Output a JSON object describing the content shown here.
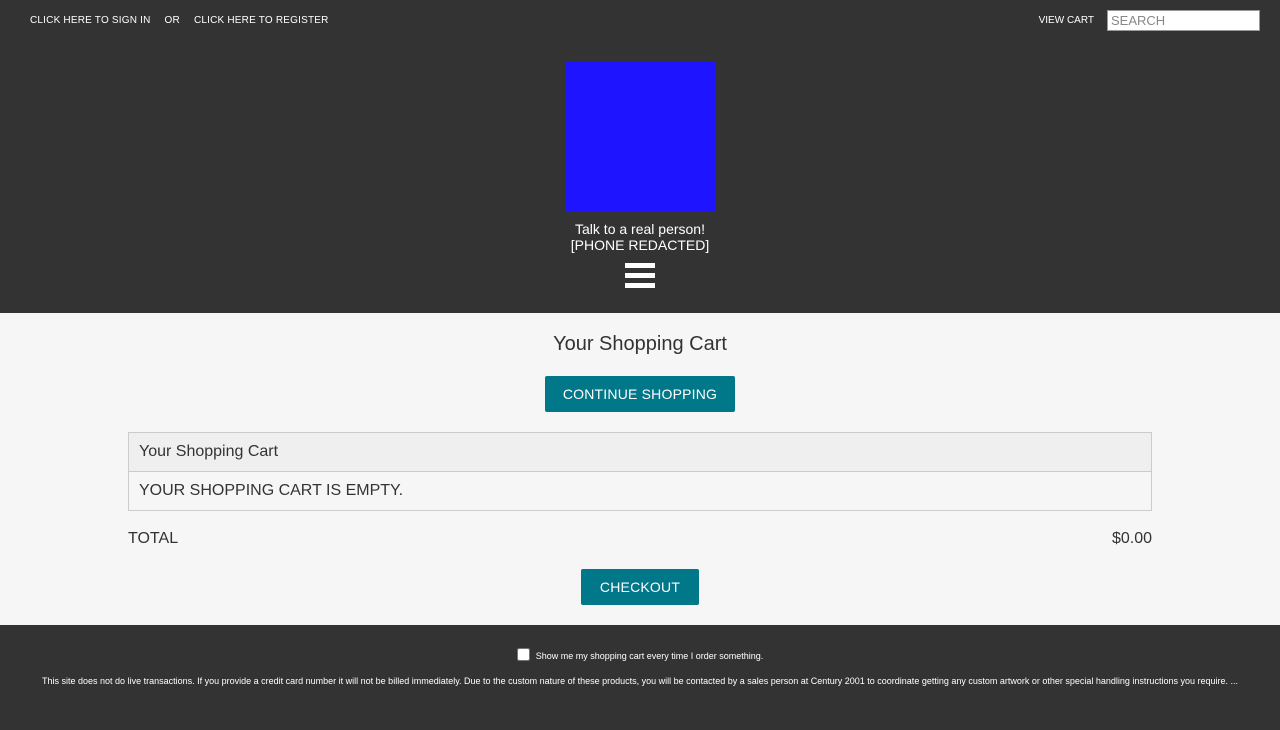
{
  "topbar": {
    "sign_in": "CLICK HERE TO SIGN IN",
    "or": "OR",
    "register": "CLICK HERE TO REGISTER",
    "view_cart": "VIEW CART",
    "search_placeholder": "SEARCH"
  },
  "header": {
    "logo_color": "#1e14ff",
    "contact_line1": "Talk to a real person!",
    "contact_line2": "[PHONE REDACTED]",
    "menu_icon": "hamburger-menu-icon"
  },
  "main": {
    "title": "Your Shopping Cart",
    "continue_label": "CONTINUE SHOPPING",
    "table": {
      "header": "Your Shopping Cart",
      "empty_message": "YOUR SHOPPING CART IS EMPTY."
    },
    "total_label": "TOTAL",
    "total_value": "$0.00",
    "checkout_label": "CHECKOUT"
  },
  "footer": {
    "checkbox_label": "Show me my shopping cart every time I order something.",
    "note": "This site does not do live transactions. If you provide a credit card number it will not be billed immediately. Due to the custom nature of these products, you will be contacted by a sales person at Century 2001 to coordinate getting any custom artwork or other special handling instructions you require. ..."
  },
  "colors": {
    "header_bg": "#333333",
    "accent": "#00788a",
    "page_bg": "#f6f6f6"
  }
}
